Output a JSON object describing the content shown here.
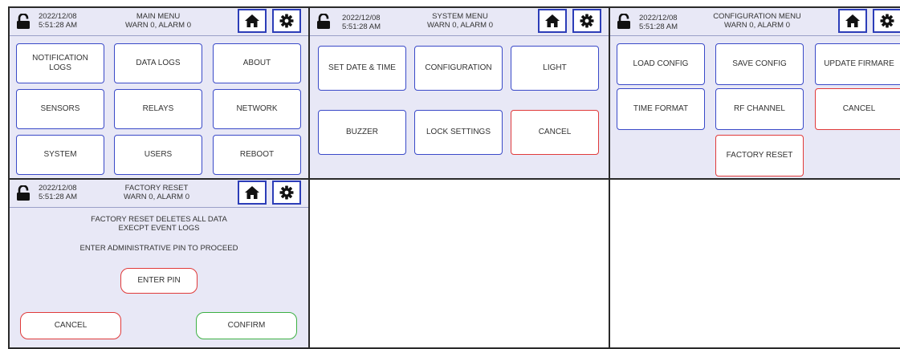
{
  "colors": {
    "panel_bg": "#e8e8f6",
    "button_border": "#3a4ac8",
    "icon_button_border": "#2c3db8",
    "cancel_border": "#e03a3a",
    "confirm_border": "#3cb043",
    "frame_border": "#2a2a2a"
  },
  "status": {
    "date": "2022/12/08",
    "time": "5:51:28 AM",
    "alerts": "WARN 0, ALARM 0"
  },
  "icons": [
    "lock-open-icon",
    "home-icon",
    "gear-icon"
  ],
  "main_menu": {
    "title": "MAIN MENU",
    "buttons": [
      "NOTIFICATION\nLOGS",
      "DATA LOGS",
      "ABOUT",
      "SENSORS",
      "RELAYS",
      "NETWORK",
      "SYSTEM",
      "USERS",
      "REBOOT"
    ]
  },
  "system_menu": {
    "title": "SYSTEM MENU",
    "buttons": [
      "SET DATE & TIME",
      "CONFIGURATION",
      "LIGHT",
      "BUZZER",
      "LOCK SETTINGS",
      "CANCEL"
    ]
  },
  "config_menu": {
    "title": "CONFIGURATION MENU",
    "buttons": [
      "LOAD CONFIG",
      "SAVE CONFIG",
      "UPDATE FIRMARE",
      "TIME FORMAT",
      "RF CHANNEL",
      "CANCEL",
      "FACTORY RESET"
    ]
  },
  "factory_reset": {
    "title": "FACTORY RESET",
    "message_line1": "FACTORY RESET DELETES ALL DATA",
    "message_line2": "EXECPT EVENT LOGS",
    "instruction": "ENTER ADMINISTRATIVE PIN TO PROCEED",
    "enter_pin": "ENTER PIN",
    "cancel": "CANCEL",
    "confirm": "CONFIRM"
  }
}
